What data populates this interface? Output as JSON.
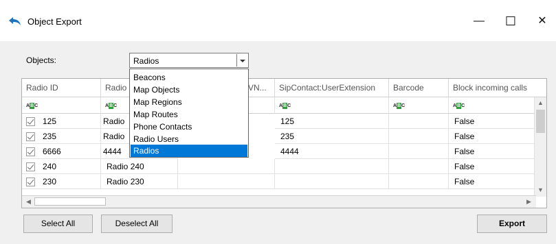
{
  "window": {
    "title": "Object Export",
    "minimize_glyph": "—",
    "maximize_glyph": "☐",
    "close_glyph": "✕",
    "icon": "undo-arrow-icon",
    "accent": "#0078d7"
  },
  "objects": {
    "label": "Objects:",
    "selected": "Radios",
    "options": [
      "Beacons",
      "Map Objects",
      "Map Regions",
      "Map Routes",
      "Phone Contacts",
      "Radio Users",
      "Radios"
    ],
    "selected_index": 6
  },
  "grid": {
    "columns": [
      "Radio ID",
      "Radio I",
      "VN...",
      "SipContact:UserExtension",
      "Barcode",
      "Block incoming calls"
    ],
    "filter_icon": "abc-filter-icon",
    "rows": [
      {
        "checked": true,
        "cells": [
          "125",
          "Radio",
          "",
          "125",
          "",
          "False"
        ]
      },
      {
        "checked": true,
        "cells": [
          "235",
          "Radio",
          "",
          "235",
          "",
          "False"
        ]
      },
      {
        "checked": true,
        "cells": [
          "6666",
          "4444",
          "",
          "4444",
          "",
          "False"
        ]
      },
      {
        "checked": true,
        "cells": [
          "240",
          "Radio 240",
          "",
          "",
          "",
          "False"
        ]
      },
      {
        "checked": true,
        "cells": [
          "230",
          "Radio 230",
          "",
          "",
          "",
          "False"
        ]
      }
    ]
  },
  "buttons": {
    "select_all": "Select All",
    "deselect_all": "Deselect All",
    "export": "Export"
  }
}
